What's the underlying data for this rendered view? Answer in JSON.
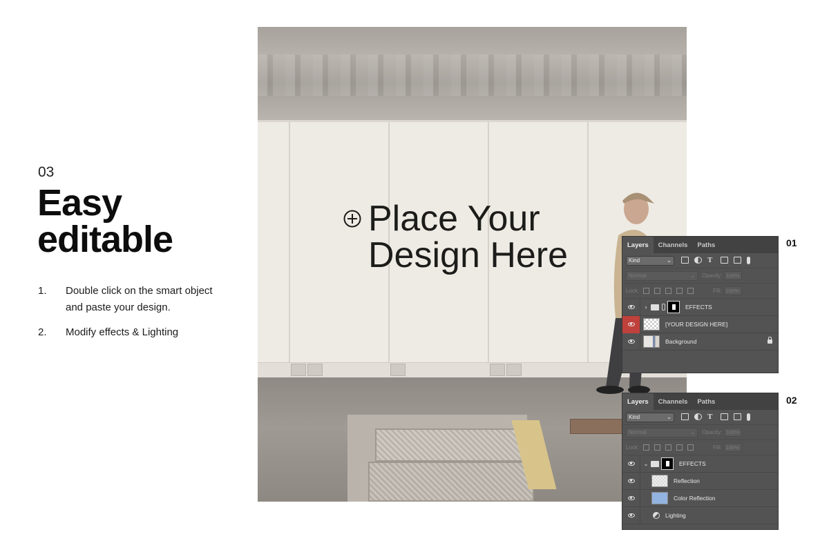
{
  "step": {
    "number": "03",
    "title": "Easy\neditable"
  },
  "instructions": [
    {
      "num": "1.",
      "text": "Double click on the smart object and paste your design."
    },
    {
      "num": "2.",
      "text": "Modify effects & Lighting"
    }
  ],
  "mockup": {
    "placeholder_text": "Place Your\nDesign Here",
    "icon": "plus-circle-icon"
  },
  "panels": [
    {
      "label": "01",
      "tabs": [
        "Layers",
        "Channels",
        "Paths"
      ],
      "kind": "Kind",
      "blend_mode": "Normal",
      "opacity_label": "Opacity:",
      "opacity_value": "100%",
      "lock_label": "Lock:",
      "fill_label": "Fill:",
      "fill_value": "100%",
      "layers": [
        {
          "name": "EFFECTS",
          "type": "group",
          "expanded": false
        },
        {
          "name": "[YOUR DESIGN HERE]",
          "type": "smart-object",
          "highlight": true
        },
        {
          "name": "Background",
          "type": "image",
          "locked": true
        }
      ]
    },
    {
      "label": "02",
      "tabs": [
        "Layers",
        "Channels",
        "Paths"
      ],
      "kind": "Kind",
      "blend_mode": "Normal",
      "opacity_label": "Opacity:",
      "opacity_value": "100%",
      "lock_label": "Lock:",
      "fill_label": "Fill:",
      "fill_value": "100%",
      "layers": [
        {
          "name": "EFFECTS",
          "type": "group",
          "expanded": true
        },
        {
          "name": "Reflection",
          "type": "layer"
        },
        {
          "name": "Color Reflection",
          "type": "color-layer"
        },
        {
          "name": "Lighting",
          "type": "adjustment"
        }
      ]
    }
  ],
  "colors": {
    "highlight_eye": "#c0413b",
    "panel_bg": "#535353",
    "color_reflection": "#93b3e0"
  }
}
